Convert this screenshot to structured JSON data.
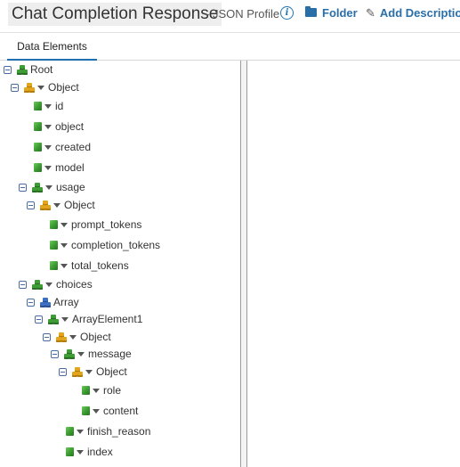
{
  "header": {
    "title": "Chat Completion Response",
    "subtitle": "- JSON Profile",
    "info_icon_glyph": "i",
    "folder_label": "Folder",
    "add_description_label": "Add Description"
  },
  "tabs": [
    {
      "label": "Data Elements",
      "active": true
    }
  ],
  "tree": [
    {
      "label": "Root"
    },
    {
      "label": "Object"
    },
    {
      "label": "id"
    },
    {
      "label": "object"
    },
    {
      "label": "created"
    },
    {
      "label": "model"
    },
    {
      "label": "usage"
    },
    {
      "label": "Object"
    },
    {
      "label": "prompt_tokens"
    },
    {
      "label": "completion_tokens"
    },
    {
      "label": "total_tokens"
    },
    {
      "label": "choices"
    },
    {
      "label": "Array"
    },
    {
      "label": "ArrayElement1"
    },
    {
      "label": "Object"
    },
    {
      "label": "message"
    },
    {
      "label": "Object"
    },
    {
      "label": "role"
    },
    {
      "label": "content"
    },
    {
      "label": "finish_reason"
    },
    {
      "label": "index"
    }
  ],
  "colors": {
    "link": "#2a6ea8",
    "tab_underline": "#1f6fb0",
    "element_green": "#3e9d35",
    "object_yellow": "#e3a51b",
    "array_blue": "#3d6fc2"
  }
}
